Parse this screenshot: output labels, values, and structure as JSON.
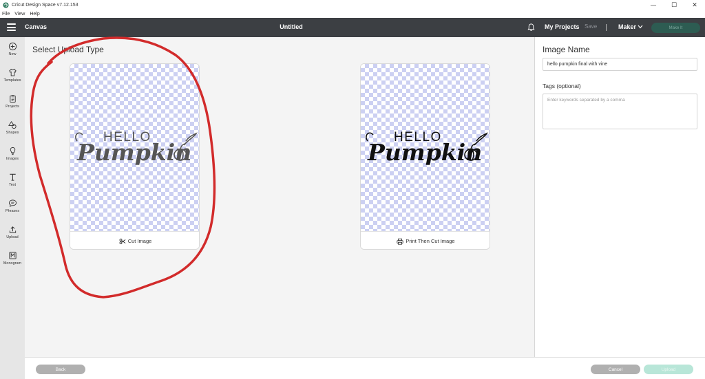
{
  "window": {
    "title": "Cricut Design Space  v7.12.153",
    "controls": {
      "minimize": "—",
      "maximize": "☐",
      "close": "✕"
    }
  },
  "menu": [
    "File",
    "View",
    "Help"
  ],
  "header": {
    "canvas_label": "Canvas",
    "document_title": "Untitled",
    "my_projects": "My Projects",
    "save": "Save",
    "machine": "Maker",
    "make_it": "Make It"
  },
  "sidebar": {
    "items": [
      {
        "label": "New",
        "icon": "plus-circle-icon"
      },
      {
        "label": "Templates",
        "icon": "shirt-icon"
      },
      {
        "label": "Projects",
        "icon": "clipboard-icon"
      },
      {
        "label": "Shapes",
        "icon": "shapes-icon"
      },
      {
        "label": "Images",
        "icon": "lightbulb-icon"
      },
      {
        "label": "Text",
        "icon": "text-icon"
      },
      {
        "label": "Phrases",
        "icon": "speech-bubble-icon"
      },
      {
        "label": "Upload",
        "icon": "upload-icon"
      },
      {
        "label": "Monogram",
        "icon": "monogram-icon"
      }
    ]
  },
  "main": {
    "title": "Select Upload Type",
    "cards": [
      {
        "label": "Cut Image",
        "icon": "scissors-icon",
        "art_hello": "HELLO",
        "art_word": "Pumpkin",
        "art_color": "#555555"
      },
      {
        "label": "Print Then Cut Image",
        "icon": "printer-icon",
        "art_hello": "HELLO",
        "art_word": "Pumpkin",
        "art_color": "#111111"
      }
    ]
  },
  "panel": {
    "image_name_label": "Image Name",
    "image_name_value": "hello pumpkin final with vine",
    "tags_label": "Tags (optional)",
    "tags_placeholder": "Enter keywords separated by a comma"
  },
  "footer": {
    "back": "Back",
    "cancel": "Cancel",
    "upload": "Upload"
  },
  "colors": {
    "header_bg": "#3c3f43",
    "make_it_bg": "#2d5c52",
    "upload_bg": "#b8e6d8",
    "annotation_red": "#d22b2b",
    "checker": "#ccd0f2"
  }
}
